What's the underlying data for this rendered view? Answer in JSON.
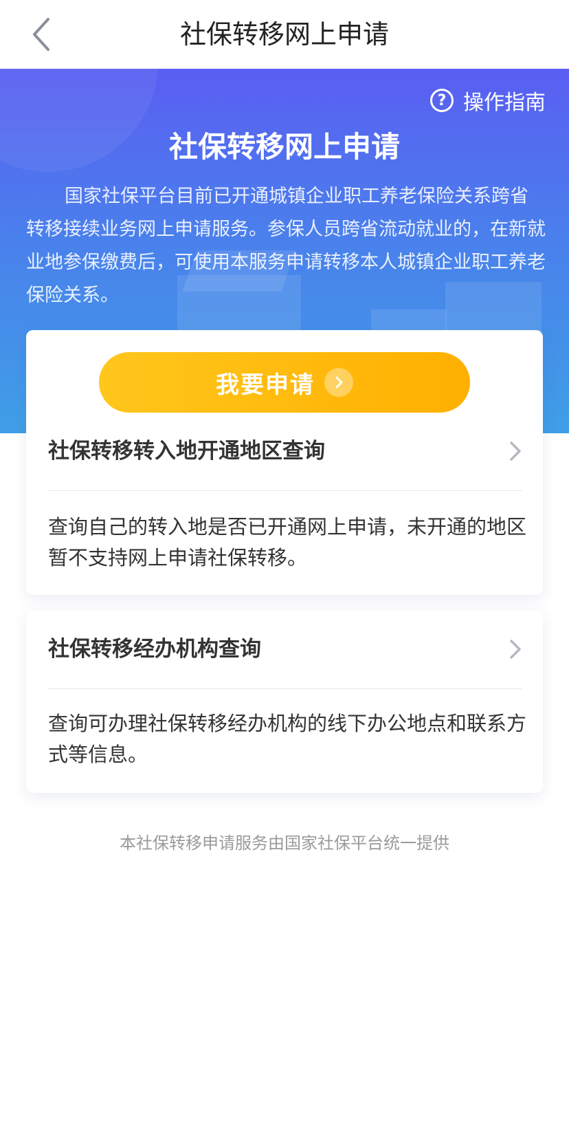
{
  "nav": {
    "title": "社保转移网上申请",
    "back_icon": "chevron-left-icon"
  },
  "banner": {
    "guide_icon_glyph": "?",
    "guide_label": "操作指南",
    "title": "社保转移网上申请",
    "description": "国家社保平台目前已开通城镇企业职工养老保险关系跨省转移接续业务网上申请服务。参保人员跨省流动就业的，在新就业地参保缴费后，可使用本服务申请转移本人城镇企业职工养老保险关系。"
  },
  "apply": {
    "label": "我要申请",
    "icon": "arrow-right-circle-icon"
  },
  "cards": [
    {
      "title": "社保转移转入地开通地区查询",
      "description": "查询自己的转入地是否已开通网上申请，未开通的地区暂不支持网上申请社保转移。"
    },
    {
      "title": "社保转移经办机构查询",
      "description": "查询可办理社保转移经办机构的线下办公地点和联系方式等信息。"
    }
  ],
  "footer": "本社保转移申请服务由国家社保平台统一提供",
  "colors": {
    "banner_top": "#5a5ef2",
    "banner_bottom": "#3f9fe6",
    "button_start": "#ffc61c",
    "button_end": "#ffb000"
  }
}
